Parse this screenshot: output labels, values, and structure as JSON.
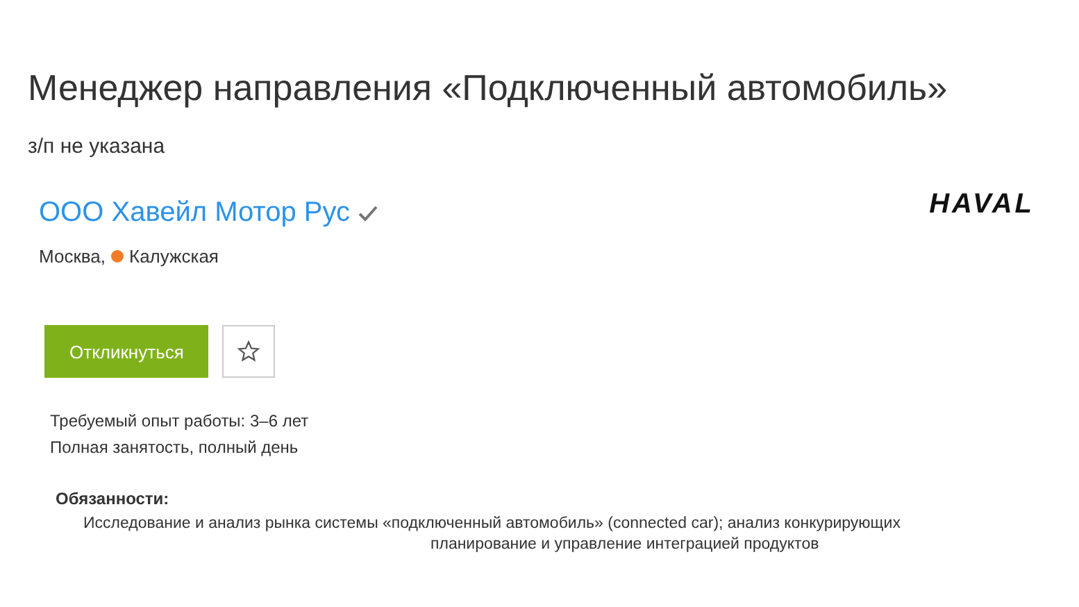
{
  "vacancy": {
    "title": "Менеджер направления «Подключенный автомобиль»",
    "salary": "з/п не указана"
  },
  "company": {
    "name": "ООО Хавейл Мотор Рус",
    "verified": true,
    "city": "Москва,",
    "metro": {
      "name": "Калужская",
      "color": "#f07c28"
    },
    "logo": "HAVAL"
  },
  "actions": {
    "apply": "Откликнуться",
    "favorite": false
  },
  "conditions": [
    "Требуемый опыт работы: 3–6 лет",
    "Полная занятость, полный день"
  ],
  "description": {
    "heading": "Обязанности:",
    "lines": [
      "Исследование и анализ рынка системы «подключенный автомобиль» (connected car); анализ конкурирующих",
      "планирование и управление интеграцией продуктов"
    ]
  }
}
